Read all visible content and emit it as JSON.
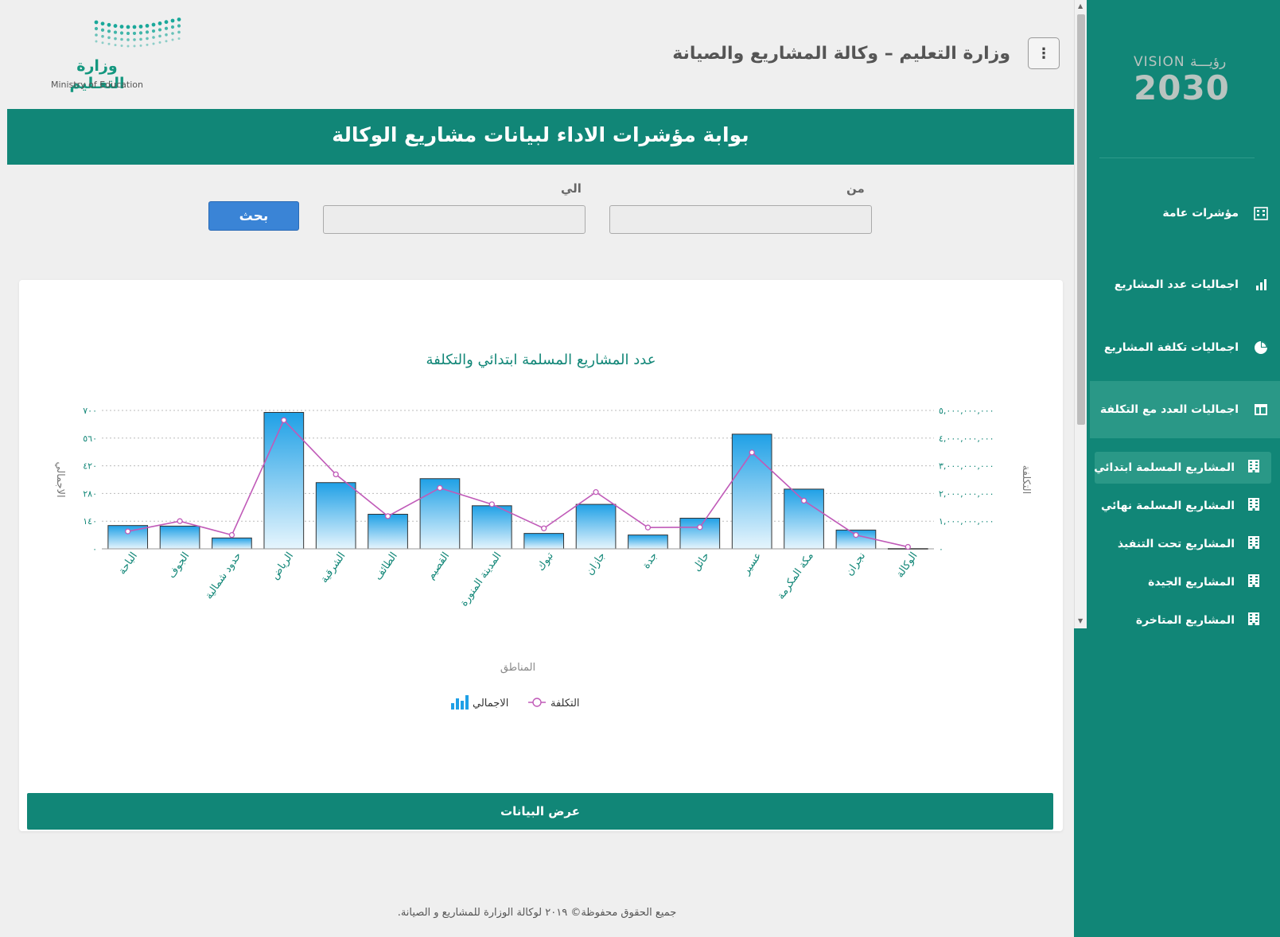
{
  "header": {
    "logo_ar": "وزارة التعـليم",
    "logo_en": "Ministry of Education",
    "title": "وزارة التعليم – وكالة المشاريع والصيانة",
    "menu_icon": "kebab-icon"
  },
  "banner": {
    "title": "بوابة مؤشرات الاداء لبيانات مشاريع الوكالة"
  },
  "filters": {
    "from_label": "من",
    "to_label": "الي",
    "from_value": "",
    "to_value": "",
    "search_label": "بحث"
  },
  "chart_card": {
    "show_data_label": "عرض البيانات"
  },
  "chart_data": {
    "type": "bar",
    "title": "عدد المشاريع المسلمة ابتدائي والتكلفة",
    "xlabel": "المناطق",
    "ylabel": "الاجمالي",
    "y2label": "التكلفة",
    "categories": [
      "الباحة",
      "الجوف",
      "حدود شمالية",
      "الرياض",
      "الشرقية",
      "الطائف",
      "القصيم",
      "المدينة المنورة",
      "تبوك",
      "جازان",
      "جدة",
      "حائل",
      "عسير",
      "مكة المكرمة",
      "نجران",
      "الوكالة"
    ],
    "series": [
      {
        "name": "الاجمالي",
        "type": "bar",
        "axis": "left",
        "values": [
          118,
          115,
          55,
          690,
          335,
          175,
          355,
          218,
          78,
          225,
          70,
          155,
          580,
          302,
          95,
          2
        ]
      },
      {
        "name": "التكلفة",
        "type": "line",
        "axis": "right",
        "values": [
          630000000,
          1000000000,
          500000000,
          4650000000,
          2690000000,
          1180000000,
          2200000000,
          1610000000,
          740000000,
          2050000000,
          770000000,
          780000000,
          3480000000,
          1740000000,
          500000000,
          70000000
        ]
      }
    ],
    "ylim": [
      0,
      700
    ],
    "y_ticks": [
      "٠",
      "١٤٠",
      "٢٨٠",
      "٤٢٠",
      "٥٦٠",
      "٧٠٠"
    ],
    "y2lim": [
      0,
      5000000000
    ],
    "y2_ticks": [
      "٠",
      "١,٠٠٠,٠٠٠,٠٠٠",
      "٢,٠٠٠,٠٠٠,٠٠٠",
      "٣,٠٠٠,٠٠٠,٠٠٠",
      "٤,٠٠٠,٠٠٠,٠٠٠",
      "٥,٠٠٠,٠٠٠,٠٠٠"
    ],
    "grid": true,
    "legend_position": "bottom",
    "colors": {
      "bar_top": "#1fa0e6",
      "bar_bottom": "#e6f5fd",
      "line": "#c05ab8",
      "axis_text": "#118677"
    }
  },
  "footer": {
    "text": "جميع الحقوق محفوظة© ٢٠١٩ لوكالة الوزارة للمشاريع و الصيانة."
  },
  "sidebar": {
    "vision_top": "VISION رؤيـــة",
    "vision_num": "2030",
    "nav": [
      {
        "label": "مؤشرات عامة",
        "icon": "building-grid-icon"
      },
      {
        "label": "اجماليات عدد المشاريع",
        "icon": "bar-chart-icon"
      },
      {
        "label": "اجماليات تكلفة المشاريع",
        "icon": "pie-chart-icon"
      },
      {
        "label": "اجماليات العدد مع التكلفة",
        "icon": "table-icon"
      }
    ],
    "sub": [
      {
        "label": "المشاريع المسلمة ابتدائي",
        "icon": "building-icon"
      },
      {
        "label": "المشاريع المسلمة نهائي",
        "icon": "building-icon"
      },
      {
        "label": "المشاريع تحت التنفيذ",
        "icon": "building-icon"
      },
      {
        "label": "المشاريع الجيدة",
        "icon": "building-icon"
      },
      {
        "label": "المشاريع المتاخرة",
        "icon": "building-icon"
      }
    ]
  }
}
